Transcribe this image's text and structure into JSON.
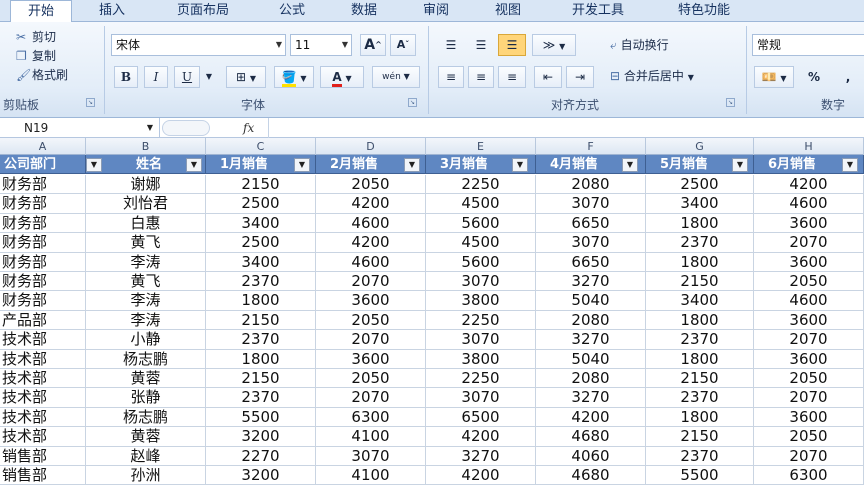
{
  "tabs": [
    "开始",
    "插入",
    "页面布局",
    "公式",
    "数据",
    "审阅",
    "视图",
    "开发工具",
    "特色功能"
  ],
  "active_tab": "开始",
  "ribbon": {
    "clipboard": {
      "cut": "剪切",
      "copy": "复制",
      "format_painter": "格式刷",
      "label": "剪贴板"
    },
    "font": {
      "name": "宋体",
      "size": "11",
      "grow": "A",
      "shrink": "A",
      "bold": "B",
      "italic": "I",
      "underline": "U",
      "phonetic": "wén",
      "label": "字体",
      "highlight_color": "#ffe100",
      "font_color": "#e0201b"
    },
    "alignment": {
      "wrap_text": "自动换行",
      "merge_center": "合并后居中",
      "label": "对齐方式"
    },
    "number": {
      "format": "常规",
      "percent": "%",
      "comma": ",",
      "label": "数字"
    }
  },
  "formula_bar": {
    "name_box": "N19",
    "fx": "fx",
    "value": ""
  },
  "columns": [
    "A",
    "B",
    "C",
    "D",
    "E",
    "F",
    "G",
    "H"
  ],
  "table": {
    "headers": [
      "公司部门",
      "姓名",
      "1月销售",
      "2月销售",
      "3月销售",
      "4月销售",
      "5月销售",
      "6月销售"
    ],
    "rows": [
      [
        "财务部",
        "谢娜",
        "2150",
        "2050",
        "2250",
        "2080",
        "2500",
        "4200"
      ],
      [
        "财务部",
        "刘怡君",
        "2500",
        "4200",
        "4500",
        "3070",
        "3400",
        "4600"
      ],
      [
        "财务部",
        "白惠",
        "3400",
        "4600",
        "5600",
        "6650",
        "1800",
        "3600"
      ],
      [
        "财务部",
        "黄飞",
        "2500",
        "4200",
        "4500",
        "3070",
        "2370",
        "2070"
      ],
      [
        "财务部",
        "李涛",
        "3400",
        "4600",
        "5600",
        "6650",
        "1800",
        "3600"
      ],
      [
        "财务部",
        "黄飞",
        "2370",
        "2070",
        "3070",
        "3270",
        "2150",
        "2050"
      ],
      [
        "财务部",
        "李涛",
        "1800",
        "3600",
        "3800",
        "5040",
        "3400",
        "4600"
      ],
      [
        "产品部",
        "李涛",
        "2150",
        "2050",
        "2250",
        "2080",
        "1800",
        "3600"
      ],
      [
        "技术部",
        "小静",
        "2370",
        "2070",
        "3070",
        "3270",
        "2370",
        "2070"
      ],
      [
        "技术部",
        "杨志鹏",
        "1800",
        "3600",
        "3800",
        "5040",
        "1800",
        "3600"
      ],
      [
        "技术部",
        "黄蓉",
        "2150",
        "2050",
        "2250",
        "2080",
        "2150",
        "2050"
      ],
      [
        "技术部",
        "张静",
        "2370",
        "2070",
        "3070",
        "3270",
        "2370",
        "2070"
      ],
      [
        "技术部",
        "杨志鹏",
        "5500",
        "6300",
        "6500",
        "4200",
        "1800",
        "3600"
      ],
      [
        "技术部",
        "黄蓉",
        "3200",
        "4100",
        "4200",
        "4680",
        "2150",
        "2050"
      ],
      [
        "销售部",
        "赵峰",
        "2270",
        "3070",
        "3270",
        "4060",
        "2370",
        "2070"
      ],
      [
        "销售部",
        "孙洲",
        "3200",
        "4100",
        "4200",
        "4680",
        "5500",
        "6300"
      ]
    ]
  }
}
